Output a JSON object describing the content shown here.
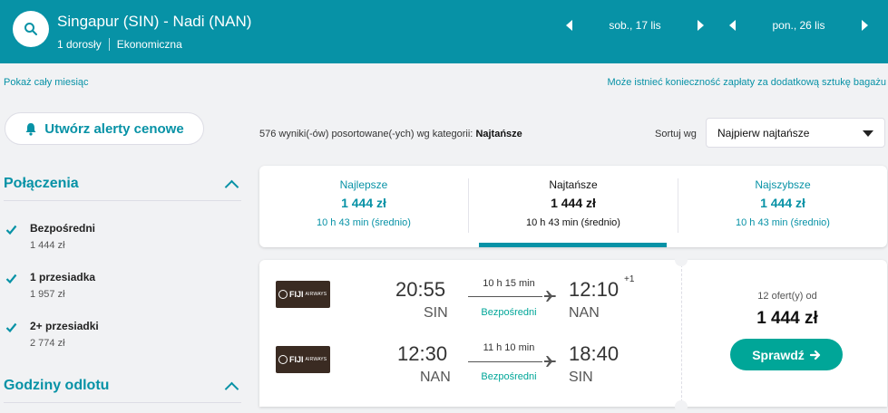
{
  "header": {
    "route": "Singapur (SIN) - Nadi (NAN)",
    "passengers": "1 dorosły",
    "cabin": "Ekonomiczna",
    "depart_date": "sob., 17 lis",
    "return_date": "pon., 26 lis"
  },
  "links": {
    "whole_month": "Pokaż cały miesiąc",
    "baggage_note": "Może istnieć konieczność zapłaty za dodatkową sztukę bagażu"
  },
  "sidebar": {
    "alert_button": "Utwórz alerty cenowe",
    "connections_title": "Połączenia",
    "options": [
      {
        "label": "Bezpośredni",
        "price": "1 444 zł",
        "checked": true
      },
      {
        "label": "1 przesiadka",
        "price": "1 957 zł",
        "checked": true
      },
      {
        "label": "2+ przesiadki",
        "price": "2 774 zł",
        "checked": true
      }
    ],
    "departure_times_title": "Godziny odlotu"
  },
  "results": {
    "count_text": "576 wyniki(-ów) posortowane(-ych) wg kategorii: ",
    "count_category": "Najtańsze",
    "sort_label": "Sortuj wg",
    "sort_value": "Najpierw najtańsze"
  },
  "tabs": [
    {
      "name": "Najlepsze",
      "price": "1 444 zł",
      "duration": "10 h 43 min (średnio)"
    },
    {
      "name": "Najtańsze",
      "price": "1 444 zł",
      "duration": "10 h 43 min (średnio)"
    },
    {
      "name": "Najszybsze",
      "price": "1 444 zł",
      "duration": "10 h 43 min (średnio)"
    }
  ],
  "result": {
    "legs": [
      {
        "airline": "FIJI",
        "airline_sub": "AIRWAYS",
        "dep_time": "20:55",
        "dep_code": "SIN",
        "duration": "10 h 15 min",
        "stops": "Bezpośredni",
        "arr_time": "12:10",
        "arr_code": "NAN",
        "day_offset": "+1"
      },
      {
        "airline": "FIJI",
        "airline_sub": "AIRWAYS",
        "dep_time": "12:30",
        "dep_code": "NAN",
        "duration": "11 h 10 min",
        "stops": "Bezpośredni",
        "arr_time": "18:40",
        "arr_code": "SIN",
        "day_offset": ""
      }
    ],
    "offers_text": "12 ofert(y) od",
    "price": "1 444 zł",
    "button": "Sprawdź"
  },
  "colors": {
    "brand": "#0792a6",
    "accent_green": "#00a698",
    "background": "#f1f2f4"
  }
}
